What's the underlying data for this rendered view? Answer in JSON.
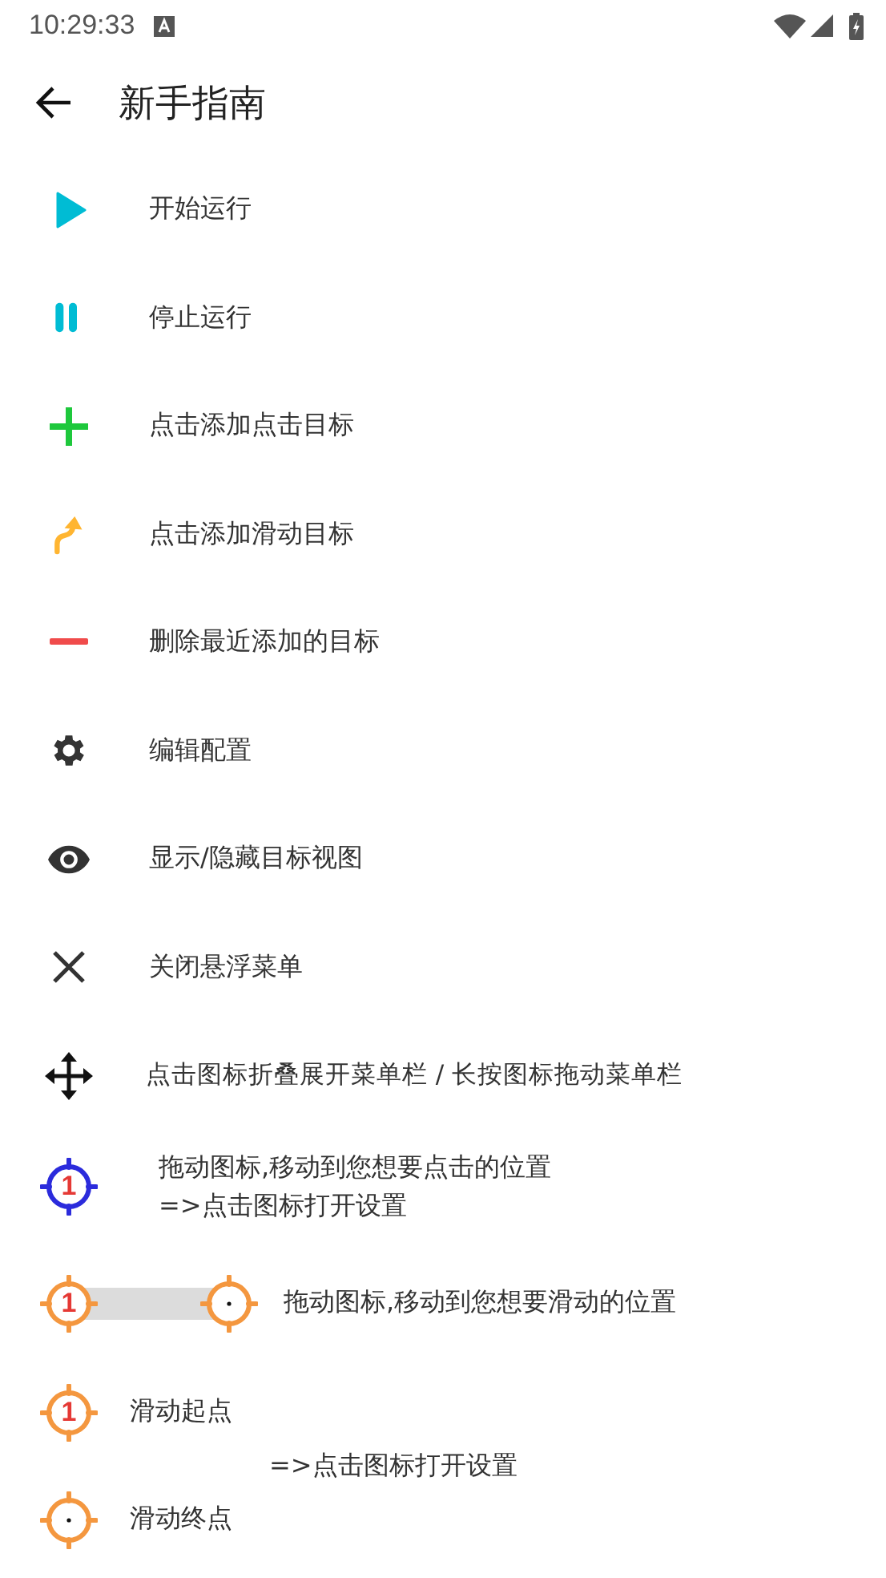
{
  "status_bar": {
    "time": "10:29:33"
  },
  "header": {
    "title": "新手指南"
  },
  "items": [
    {
      "kind": "play",
      "text": "开始运行"
    },
    {
      "kind": "pause",
      "text": "停止运行"
    },
    {
      "kind": "plus",
      "text": "点击添加点击目标"
    },
    {
      "kind": "swipe",
      "text": "点击添加滑动目标"
    },
    {
      "kind": "minus",
      "text": "删除最近添加的目标"
    },
    {
      "kind": "gear",
      "text": "编辑配置"
    },
    {
      "kind": "eye",
      "text": "显示/隐藏目标视图"
    },
    {
      "kind": "close",
      "text": "关闭悬浮菜单"
    },
    {
      "kind": "move",
      "text": "点击图标折叠展开菜单栏 / 长按图标拖动菜单栏"
    }
  ],
  "tap_target": {
    "number": "1",
    "lines": [
      "拖动图标,移动到您想要点击的位置",
      "=>点击图标打开设置"
    ]
  },
  "swipe_target": {
    "number": "1",
    "text": "拖动图标,移动到您想要滑动的位置"
  },
  "swipe_start": {
    "number": "1",
    "text": "滑动起点"
  },
  "swipe_hint": "=>点击图标打开设置",
  "swipe_end": {
    "text": "滑动终点"
  }
}
